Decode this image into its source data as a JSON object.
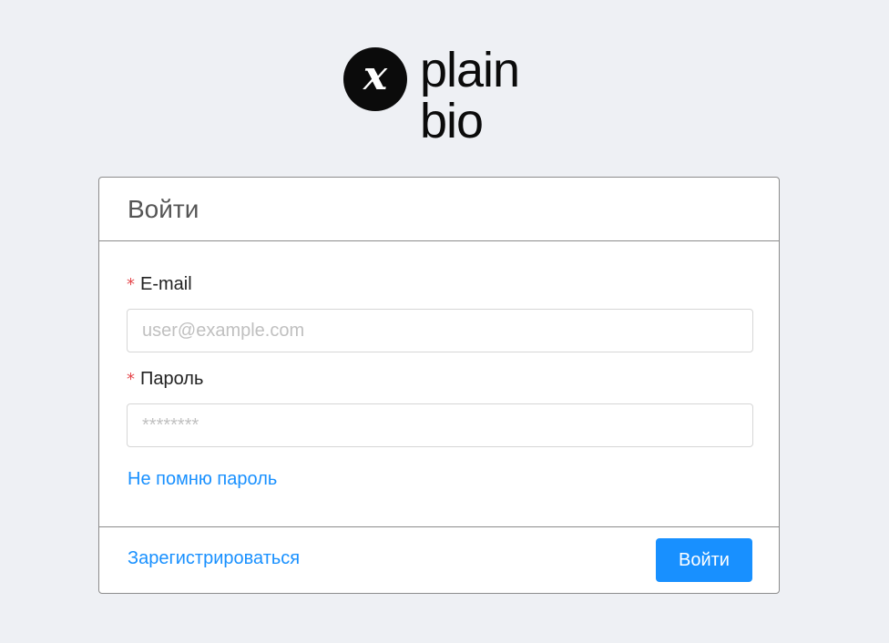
{
  "logo": {
    "mark": "x",
    "line1": "plain",
    "line2": "bio"
  },
  "card": {
    "title": "Войти"
  },
  "form": {
    "email": {
      "required_mark": "*",
      "label": "E-mail",
      "value": "",
      "placeholder": "user@example.com"
    },
    "password": {
      "required_mark": "*",
      "label": "Пароль",
      "value": "",
      "placeholder": "********"
    },
    "forgot_label": "Не помню пароль"
  },
  "footer": {
    "register_label": "Зарегистрироваться",
    "submit_label": "Войти"
  },
  "colors": {
    "accent": "#1890ff",
    "required": "#e5484d",
    "background": "#eef0f4"
  }
}
